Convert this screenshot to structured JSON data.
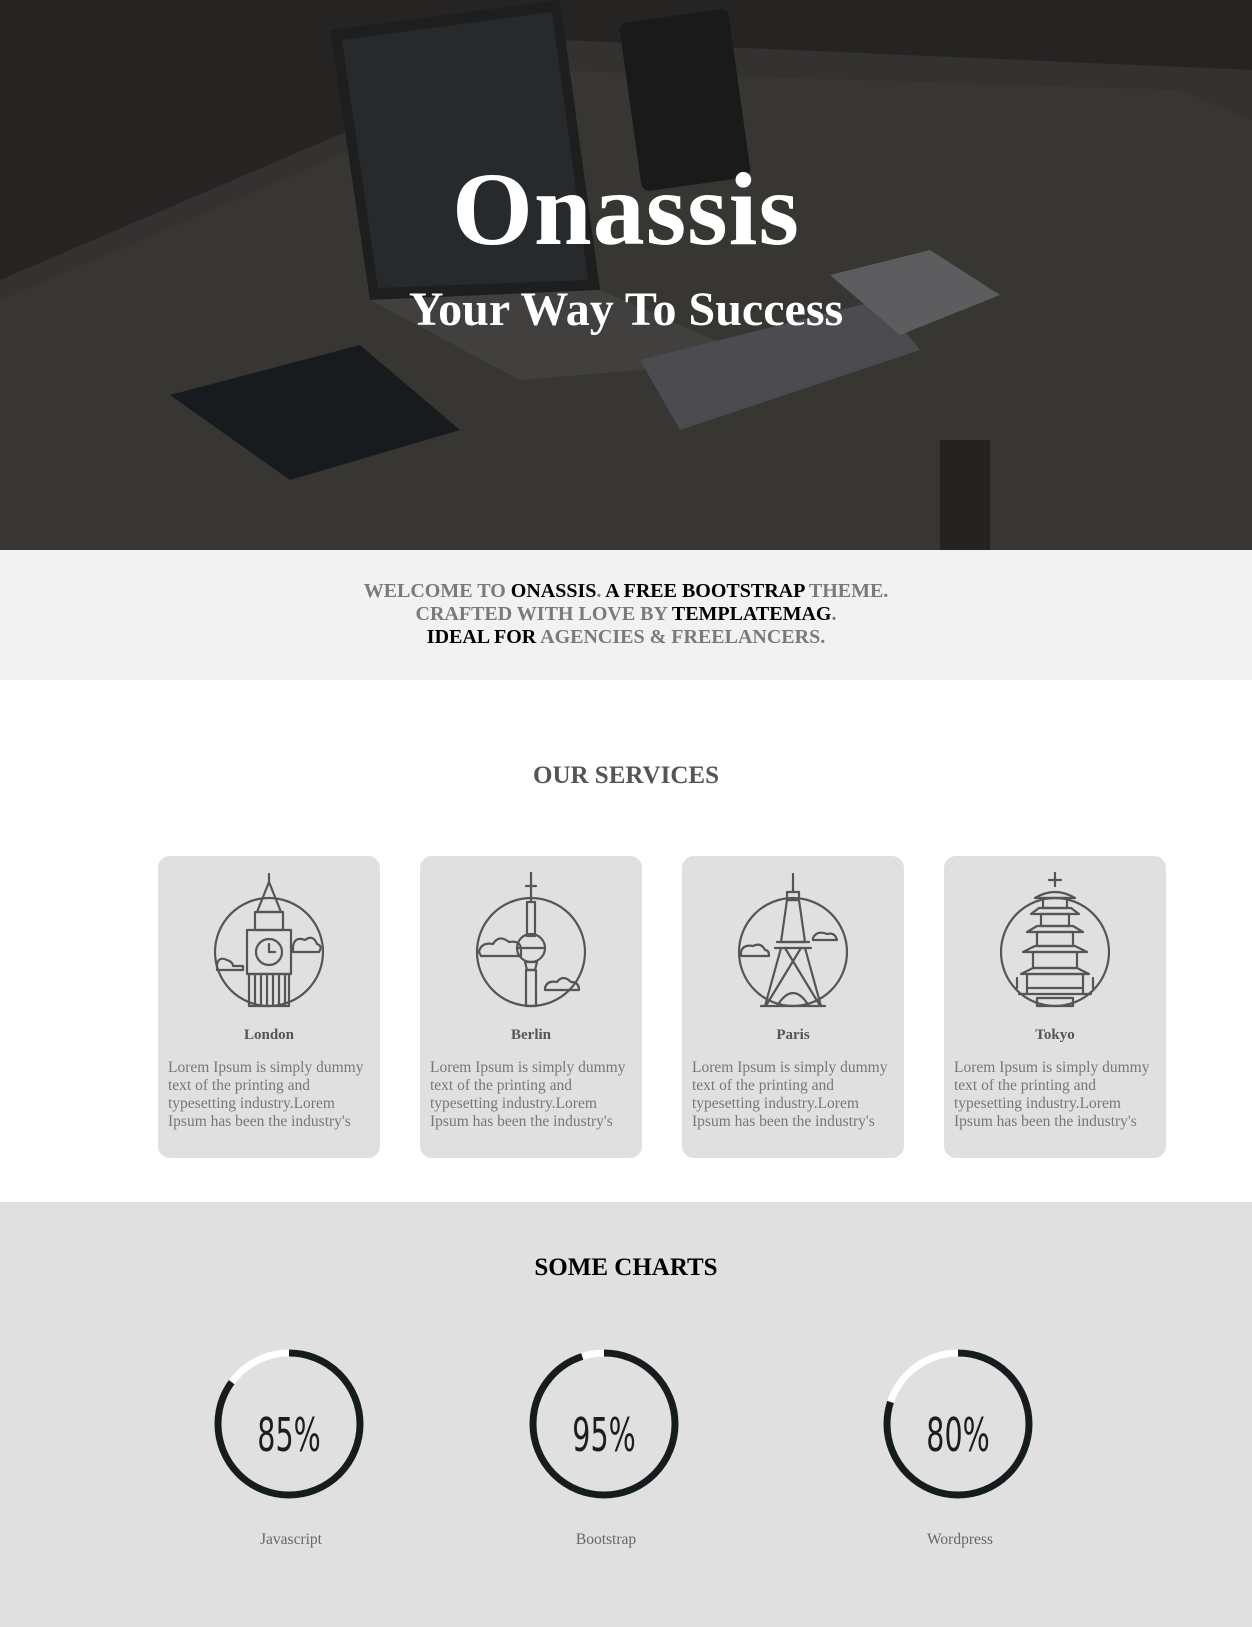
{
  "hero": {
    "title": "Onassis",
    "subtitle": "Your Way To Success"
  },
  "welcome": {
    "line1": {
      "p1": "WELCOME TO ",
      "p2": "ONASSIS",
      "p3": ". ",
      "p4": "A FREE BOOTSTRAP",
      "p5": " THEME."
    },
    "line2": {
      "p1": "CRAFTED WITH LOVE BY ",
      "p2": "TEMPLATEMAG",
      "p3": "."
    },
    "line3": {
      "p1": "IDEAL FOR",
      "p2": " AGENCIES & FREELANCERS."
    }
  },
  "services": {
    "title": "OUR SERVICES",
    "items": [
      {
        "city": "London",
        "icon": "big-ben-icon",
        "text": "Lorem Ipsum is simply dummy text of the printing and typesetting industry.Lorem Ipsum has been the industry's"
      },
      {
        "city": "Berlin",
        "icon": "tv-tower-icon",
        "text": "Lorem Ipsum is simply dummy text of the printing and typesetting industry.Lorem Ipsum has been the industry's"
      },
      {
        "city": "Paris",
        "icon": "eiffel-tower-icon",
        "text": "Lorem Ipsum is simply dummy text of the printing and typesetting industry.Lorem Ipsum has been the industry's"
      },
      {
        "city": "Tokyo",
        "icon": "pagoda-icon",
        "text": "Lorem Ipsum is simply dummy text of the printing and typesetting industry.Lorem Ipsum has been the industry's"
      }
    ]
  },
  "charts": {
    "title": "SOME CHARTS",
    "items": [
      {
        "label": "Javascript",
        "percent_text": "85%",
        "value": 85
      },
      {
        "label": "Bootstrap",
        "percent_text": "95%",
        "value": 95
      },
      {
        "label": "Wordpress",
        "percent_text": "80%",
        "value": 80
      }
    ],
    "ring_color": "#161c1d",
    "track_color": "#ffffff"
  }
}
